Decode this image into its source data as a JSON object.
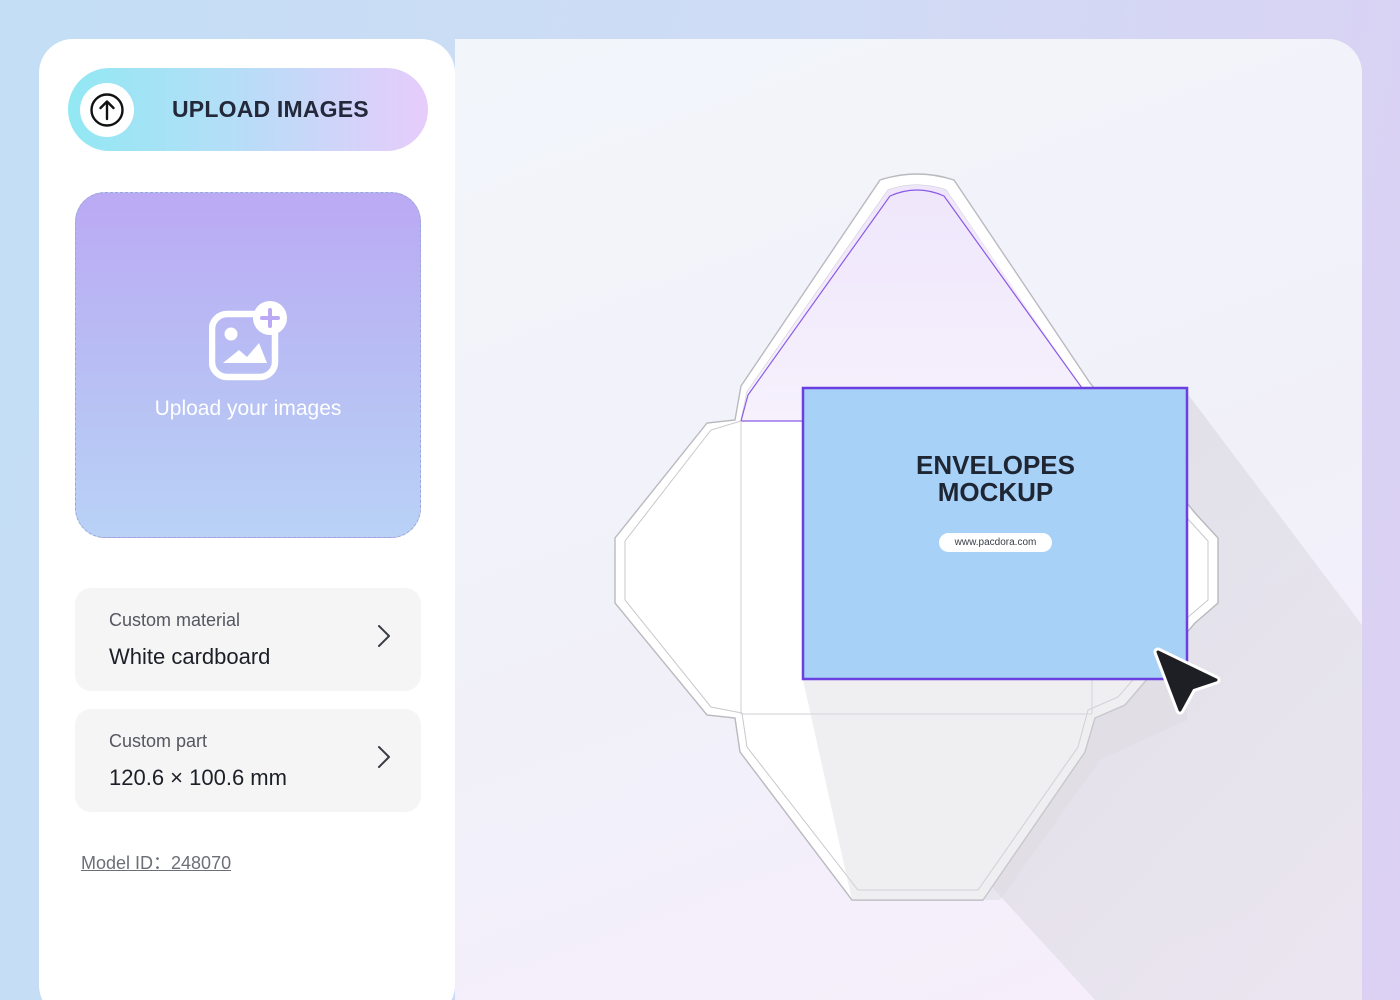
{
  "sidebar": {
    "upload_button": {
      "label": "UPLOAD IMAGES",
      "icon": "arrow-up-circle-icon"
    },
    "dropzone": {
      "label": "Upload your images",
      "icon": "add-image-icon"
    },
    "options": [
      {
        "label": "Custom material",
        "value": "White cardboard",
        "icon": "chevron-right-icon"
      },
      {
        "label": "Custom part",
        "value": "120.6 × 100.6 mm",
        "icon": "chevron-right-icon"
      }
    ],
    "model_id": "Model ID：248070"
  },
  "mockup": {
    "title_line1": "ENVELOPES",
    "title_line2": "MOCKUP",
    "url": "www.pacdora.com",
    "cursor_icon": "pointer-cursor-icon"
  },
  "colors": {
    "card_fill": "#a8d1f8",
    "selection_outline": "#6b3fe0",
    "flap_tint": "#f3ecfb"
  }
}
